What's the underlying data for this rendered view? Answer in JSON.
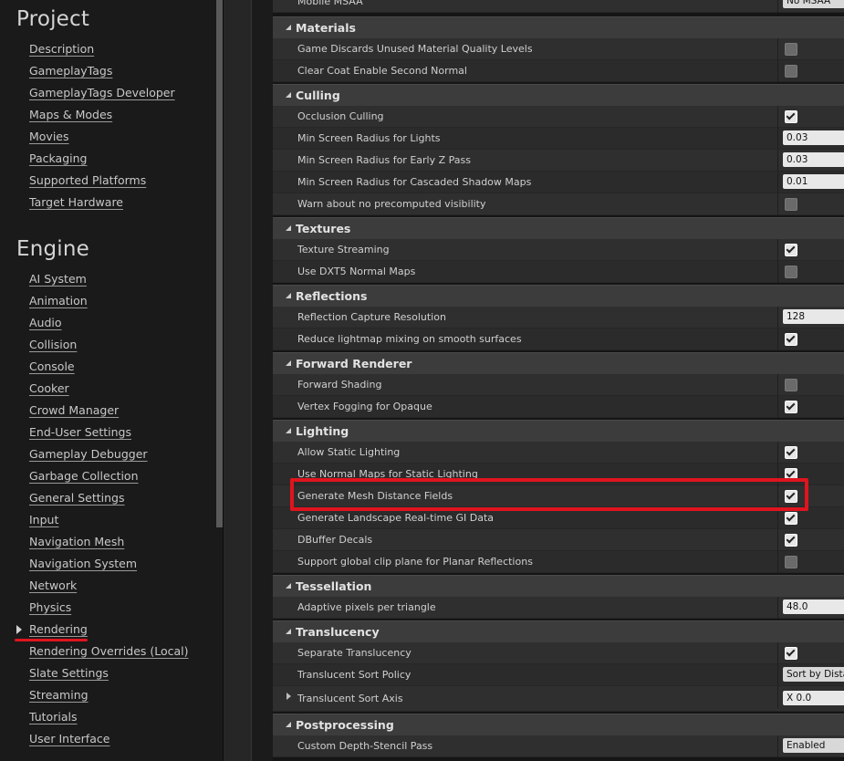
{
  "sidebar": {
    "project_title": "Project",
    "project_items": [
      "Description",
      "GameplayTags",
      "GameplayTags Developer",
      "Maps & Modes",
      "Movies",
      "Packaging",
      "Supported Platforms",
      "Target Hardware"
    ],
    "engine_title": "Engine",
    "engine_items": [
      "AI System",
      "Animation",
      "Audio",
      "Collision",
      "Console",
      "Cooker",
      "Crowd Manager",
      "End-User Settings",
      "Gameplay Debugger",
      "Garbage Collection",
      "General Settings",
      "Input",
      "Navigation Mesh",
      "Navigation System",
      "Network",
      "Physics",
      "Rendering",
      "Rendering Overrides (Local)",
      "Slate Settings",
      "Streaming",
      "Tutorials",
      "User Interface"
    ],
    "selected": "Rendering"
  },
  "panel": {
    "top_row": {
      "label": "Mobile MSAA",
      "value": "No MSAA"
    },
    "categories": [
      {
        "name": "Materials",
        "rows": [
          {
            "label": "Game Discards Unused Material Quality Levels",
            "type": "checkbox",
            "checked": false
          },
          {
            "label": "Clear Coat Enable Second Normal",
            "type": "checkbox",
            "checked": false
          }
        ]
      },
      {
        "name": "Culling",
        "rows": [
          {
            "label": "Occlusion Culling",
            "type": "checkbox",
            "checked": true
          },
          {
            "label": "Min Screen Radius for Lights",
            "type": "number",
            "value": "0.03"
          },
          {
            "label": "Min Screen Radius for Early Z Pass",
            "type": "number",
            "value": "0.03"
          },
          {
            "label": "Min Screen Radius for Cascaded Shadow Maps",
            "type": "number",
            "value": "0.01"
          },
          {
            "label": "Warn about no precomputed visibility",
            "type": "checkbox",
            "checked": false
          }
        ]
      },
      {
        "name": "Textures",
        "rows": [
          {
            "label": "Texture Streaming",
            "type": "checkbox",
            "checked": true
          },
          {
            "label": "Use DXT5 Normal Maps",
            "type": "checkbox",
            "checked": false
          }
        ]
      },
      {
        "name": "Reflections",
        "rows": [
          {
            "label": "Reflection Capture Resolution",
            "type": "number",
            "value": "128"
          },
          {
            "label": "Reduce lightmap mixing on smooth surfaces",
            "type": "checkbox",
            "checked": true
          }
        ]
      },
      {
        "name": "Forward Renderer",
        "rows": [
          {
            "label": "Forward Shading",
            "type": "checkbox",
            "checked": false
          },
          {
            "label": "Vertex Fogging for Opaque",
            "type": "checkbox",
            "checked": true
          }
        ]
      },
      {
        "name": "Lighting",
        "rows": [
          {
            "label": "Allow Static Lighting",
            "type": "checkbox",
            "checked": true
          },
          {
            "label": "Use Normal Maps for Static Lighting",
            "type": "checkbox",
            "checked": true
          },
          {
            "label": "Generate Mesh Distance Fields",
            "type": "checkbox",
            "checked": true
          },
          {
            "label": "Generate Landscape Real-time GI Data",
            "type": "checkbox",
            "checked": true
          },
          {
            "label": "DBuffer Decals",
            "type": "checkbox",
            "checked": true
          },
          {
            "label": "Support global clip plane for Planar Reflections",
            "type": "checkbox",
            "checked": false
          }
        ]
      },
      {
        "name": "Tessellation",
        "rows": [
          {
            "label": "Adaptive pixels per triangle",
            "type": "number",
            "value": "48.0"
          }
        ]
      },
      {
        "name": "Translucency",
        "rows": [
          {
            "label": "Separate Translucency",
            "type": "checkbox",
            "checked": true
          },
          {
            "label": "Translucent Sort Policy",
            "type": "dropdown",
            "value": "Sort by Distance"
          },
          {
            "label": "Translucent Sort Axis",
            "type": "vector",
            "value": "X  0.0",
            "expandable": true
          }
        ]
      },
      {
        "name": "Postprocessing",
        "rows": [
          {
            "label": "Custom Depth-Stencil Pass",
            "type": "dropdown",
            "value": "Enabled"
          }
        ]
      }
    ],
    "highlighted_row": "Generate Mesh Distance Fields"
  }
}
